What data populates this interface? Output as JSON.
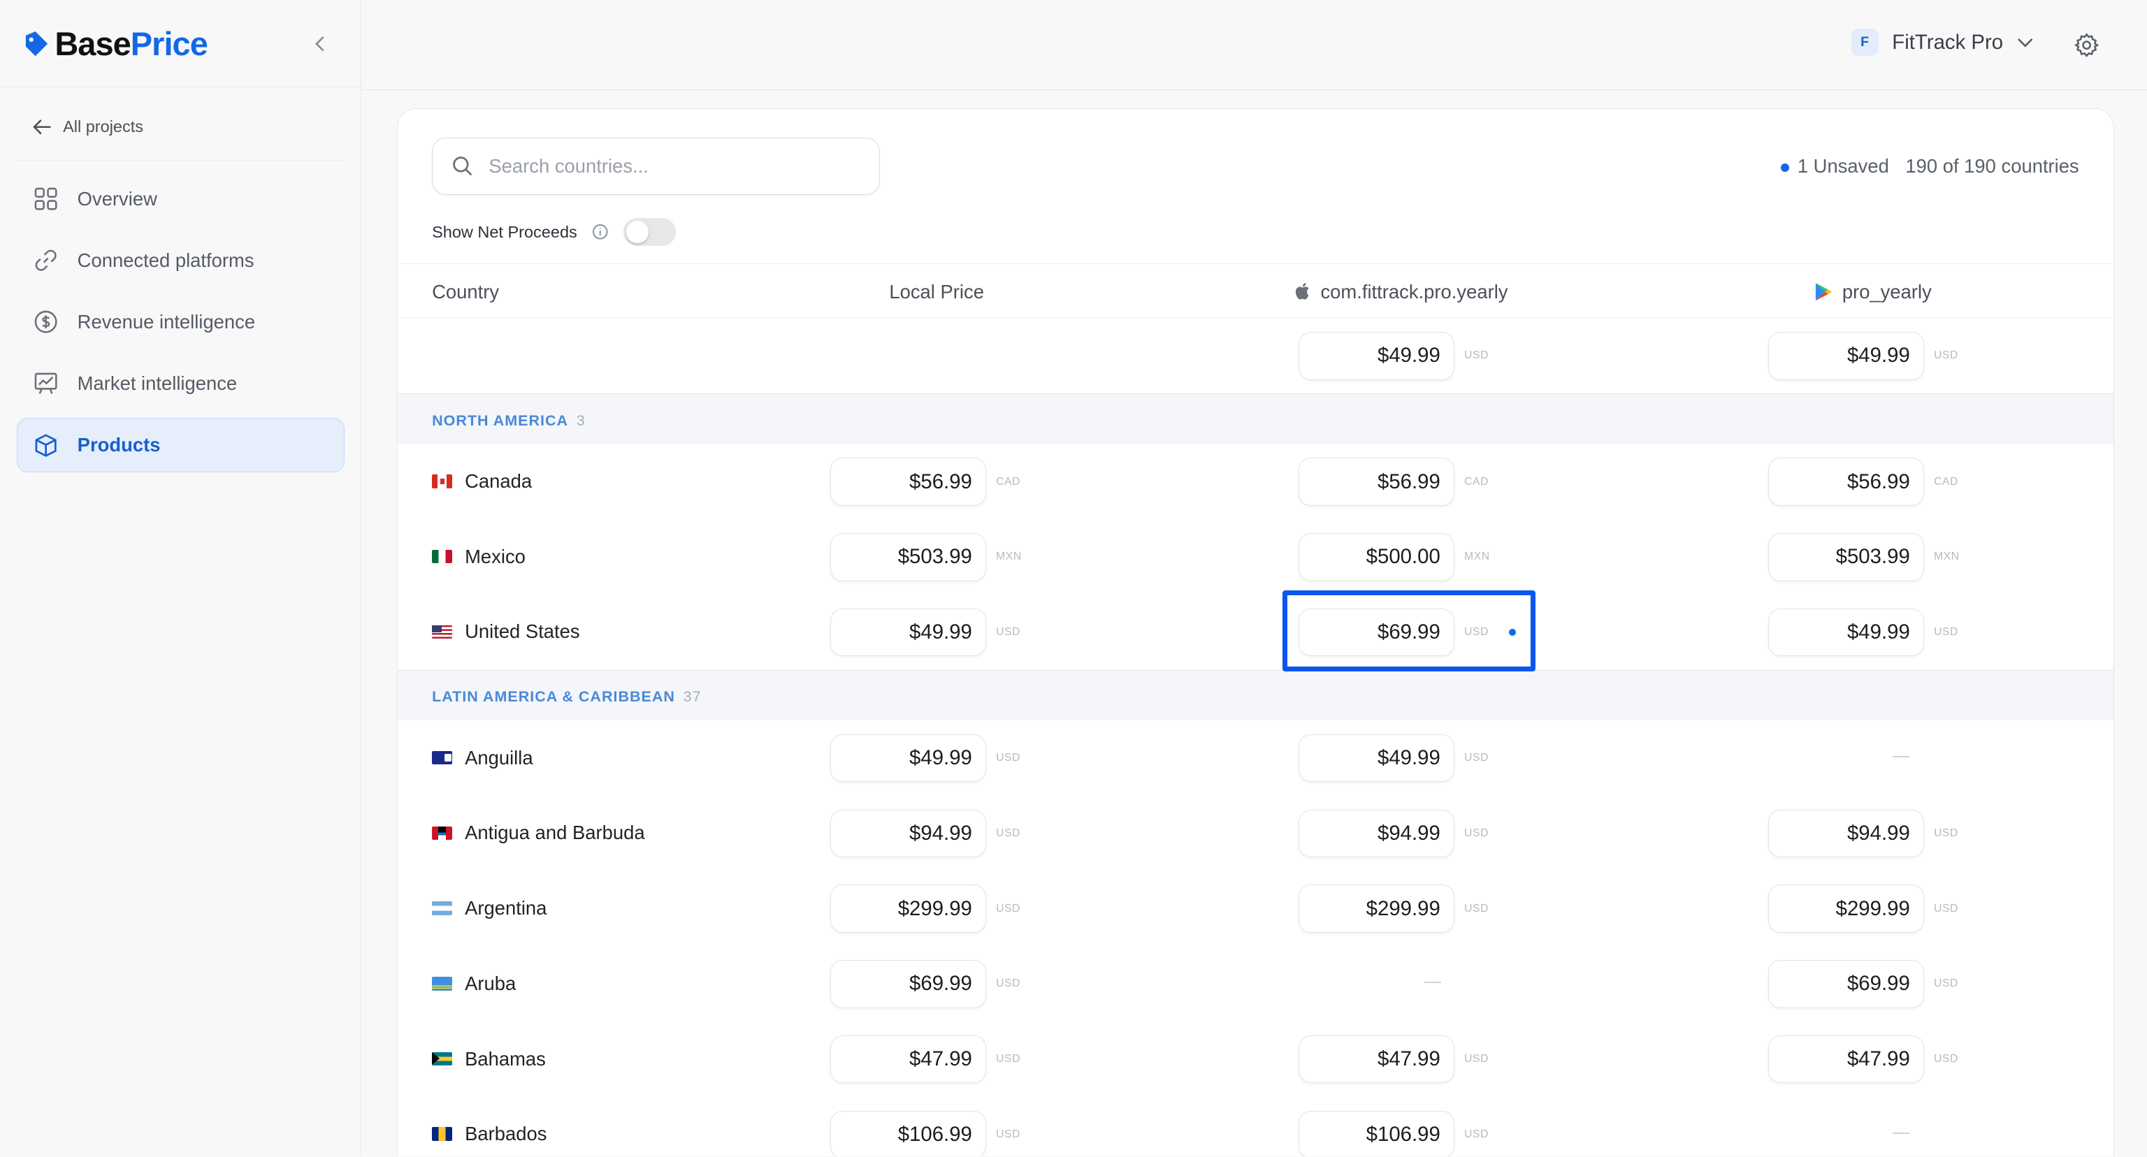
{
  "brand": {
    "name_part1": "Base",
    "name_part2": "Price",
    "logo_icon": "price-tag-icon",
    "accent": "#1468e6"
  },
  "sidebar": {
    "back_label": "All projects",
    "items": [
      {
        "label": "Overview",
        "icon": "grid-icon",
        "active": false
      },
      {
        "label": "Connected platforms",
        "icon": "link-icon",
        "active": false
      },
      {
        "label": "Revenue intelligence",
        "icon": "dollar-circle-icon",
        "active": false
      },
      {
        "label": "Market intelligence",
        "icon": "chart-board-icon",
        "active": false
      },
      {
        "label": "Products",
        "icon": "box-icon",
        "active": true
      }
    ]
  },
  "topbar": {
    "project_initial": "F",
    "project_name": "FitTrack Pro"
  },
  "toolbar": {
    "search_placeholder": "Search countries...",
    "unsaved_label": "1 Unsaved",
    "count_label": "190 of 190 countries",
    "net_proceeds_label": "Show Net Proceeds",
    "net_proceeds_on": false
  },
  "table": {
    "headers": {
      "country": "Country",
      "local": "Local Price",
      "apple": "com.fittrack.pro.yearly",
      "google": "pro_yearly"
    },
    "default_row": {
      "apple": {
        "price": "$49.99",
        "cur": "USD"
      },
      "google": {
        "price": "$49.99",
        "cur": "USD"
      }
    },
    "groups": [
      {
        "name": "NORTH AMERICA",
        "count": "3",
        "rows": [
          {
            "country": "Canada",
            "local": {
              "price": "$56.99",
              "cur": "CAD"
            },
            "apple": {
              "price": "$56.99",
              "cur": "CAD"
            },
            "google": {
              "price": "$56.99",
              "cur": "CAD"
            }
          },
          {
            "country": "Mexico",
            "local": {
              "price": "$503.99",
              "cur": "MXN"
            },
            "apple": {
              "price": "$500.00",
              "cur": "MXN"
            },
            "google": {
              "price": "$503.99",
              "cur": "MXN"
            }
          },
          {
            "country": "United States",
            "local": {
              "price": "$49.99",
              "cur": "USD"
            },
            "apple": {
              "price": "$69.99",
              "cur": "USD"
            },
            "google": {
              "price": "$49.99",
              "cur": "USD"
            }
          }
        ]
      },
      {
        "name": "LATIN AMERICA & CARIBBEAN",
        "count": "37",
        "rows": [
          {
            "country": "Anguilla",
            "local": {
              "price": "$49.99",
              "cur": "USD"
            },
            "apple": {
              "price": "$49.99",
              "cur": "USD"
            },
            "google": {
              "price": "—",
              "cur": ""
            }
          },
          {
            "country": "Antigua and Barbuda",
            "local": {
              "price": "$94.99",
              "cur": "USD"
            },
            "apple": {
              "price": "$94.99",
              "cur": "USD"
            },
            "google": {
              "price": "$94.99",
              "cur": "USD"
            }
          },
          {
            "country": "Argentina",
            "local": {
              "price": "$299.99",
              "cur": "USD"
            },
            "apple": {
              "price": "$299.99",
              "cur": "USD"
            },
            "google": {
              "price": "$299.99",
              "cur": "USD"
            }
          },
          {
            "country": "Aruba",
            "local": {
              "price": "$69.99",
              "cur": "USD"
            },
            "apple": {
              "price": "—",
              "cur": ""
            },
            "google": {
              "price": "$69.99",
              "cur": "USD"
            }
          },
          {
            "country": "Bahamas",
            "local": {
              "price": "$47.99",
              "cur": "USD"
            },
            "apple": {
              "price": "$47.99",
              "cur": "USD"
            },
            "google": {
              "price": "$47.99",
              "cur": "USD"
            }
          },
          {
            "country": "Barbados",
            "local": {
              "price": "$106.99",
              "cur": "USD"
            },
            "apple": {
              "price": "$106.99",
              "cur": "USD"
            },
            "google": {
              "price": "—",
              "cur": ""
            }
          }
        ]
      }
    ]
  }
}
